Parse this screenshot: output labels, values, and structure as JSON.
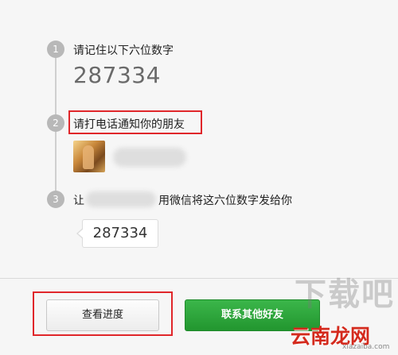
{
  "steps": [
    {
      "number": "1",
      "text": "请记住以下六位数字"
    },
    {
      "number": "2",
      "text": "请打电话通知你的朋友"
    },
    {
      "number": "3",
      "text_prefix": "让",
      "text_suffix": "用微信将这六位数字发给你"
    }
  ],
  "code": "287334",
  "bubble_code": "287334",
  "buttons": {
    "progress_label": "查看进度",
    "contact_label": "联系其他好友"
  },
  "watermark": {
    "gray": "下载吧",
    "red": "云南龙网",
    "small": "xiazaiba.com"
  },
  "colors": {
    "highlight_border": "#e0262a",
    "primary_green": "#22962f",
    "step_circle": "#b8b8b8"
  }
}
